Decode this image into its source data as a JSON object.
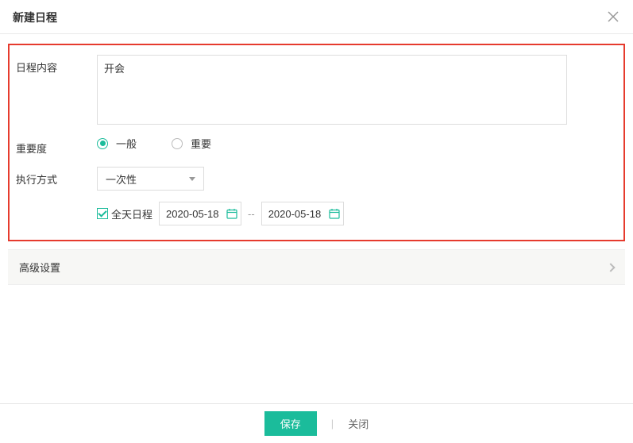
{
  "header": {
    "title": "新建日程"
  },
  "form": {
    "content": {
      "label": "日程内容",
      "value": "开会"
    },
    "importance": {
      "label": "重要度",
      "options": {
        "normal": "一般",
        "important": "重要"
      },
      "selected": "normal"
    },
    "execution": {
      "label": "执行方式",
      "selected_text": "一次性"
    },
    "all_day": {
      "label": "全天日程",
      "checked": true
    },
    "date_start": "2020-05-18",
    "date_separator": "--",
    "date_end": "2020-05-18"
  },
  "advanced": {
    "label": "高级设置"
  },
  "footer": {
    "save": "保存",
    "separator": "|",
    "close": "关闭"
  }
}
